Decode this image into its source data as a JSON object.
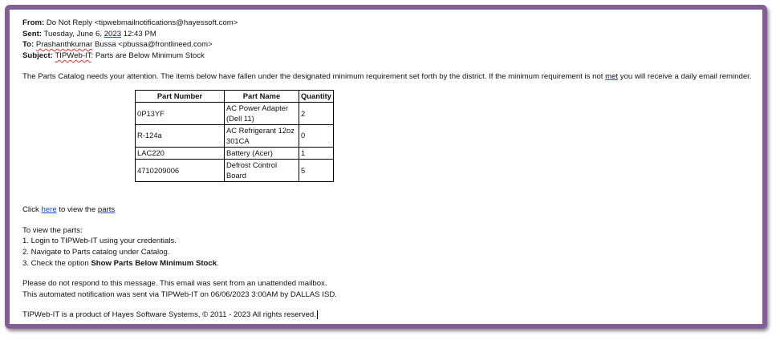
{
  "header": {
    "from_label": "From:",
    "from_value": "Do Not Reply <tipwebmailnotifications@hayessoft.com>",
    "sent_label": "Sent:",
    "sent_prefix": "Tuesday, June 6,",
    "sent_year": "2023",
    "sent_time": "12:43 PM",
    "to_label": "To:",
    "to_name": "Prashanthkumar",
    "to_rest": "Bussa <pbussa@frontlineed.com>",
    "subject_label": "Subject:",
    "subject_app": "TIPWeb-IT",
    "subject_rest": ": Parts are Below Minimum Stock"
  },
  "intro": {
    "before": "The Parts Catalog needs your attention. The items below have fallen under the designated minimum requirement set forth by the district. If the minimum requirement is not",
    "met": "met",
    "after": "you will receive a daily email reminder."
  },
  "table": {
    "headers": [
      "Part Number",
      "Part Name",
      "Quantity"
    ],
    "rows": [
      {
        "number": "0P13YF",
        "name_line1": "AC Power Adapter",
        "name_line2": "(Dell 11)",
        "qty": "2"
      },
      {
        "number": "R-124a",
        "name_line1": "AC Refrigerant 12oz",
        "name_line2": "301CA",
        "qty": "0"
      },
      {
        "number": "LAC220",
        "name_line1": "Battery (Acer)",
        "name_line2": "",
        "qty": "1"
      },
      {
        "number": "4710209006",
        "name_line1": "Defrost Control Board",
        "name_line2": "",
        "qty": "5"
      }
    ]
  },
  "click_line": {
    "before": "Click",
    "link": "here",
    "middle": "to view the",
    "parts": "parts"
  },
  "instructions": {
    "heading": "To view the parts:",
    "step1": "1. Login to TIPWeb-IT using your credentials.",
    "step2": "2. Navigate to Parts catalog under Catalog.",
    "step3_before": "3. Check the option",
    "step3_bold": "Show Parts Below Minimum Stock",
    "step3_after": "."
  },
  "notice": {
    "line1": "Please do not respond to this message. This email was sent from an unattended mailbox.",
    "line2": "This automated notification was sent via TIPWeb-IT on 06/06/2023 3:00AM by DALLAS ISD."
  },
  "footer": {
    "copyright": "TIPWeb-IT is a product of Hayes Software Systems, © 2011 - 2023 All rights reserved."
  },
  "colors": {
    "frame": "#845f95",
    "link": "#0b53c3"
  }
}
